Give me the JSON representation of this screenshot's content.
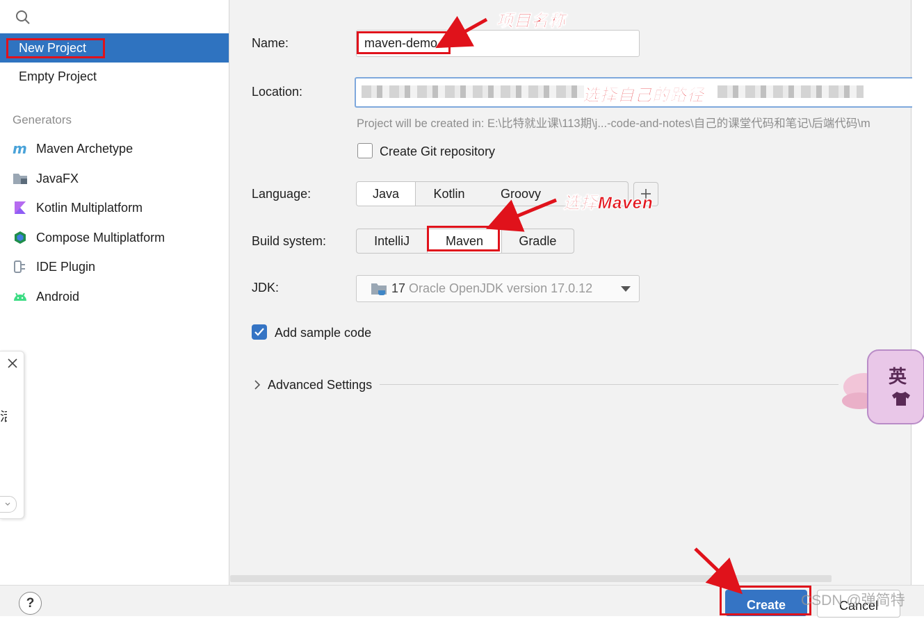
{
  "sidebar": {
    "selected": "New Project",
    "items": [
      {
        "label": "New Project"
      },
      {
        "label": "Empty Project"
      }
    ],
    "generators_heading": "Generators",
    "generators": [
      {
        "label": "Maven Archetype",
        "icon": "maven-icon"
      },
      {
        "label": "JavaFX",
        "icon": "folder-icon"
      },
      {
        "label": "Kotlin Multiplatform",
        "icon": "kotlin-icon"
      },
      {
        "label": "Compose Multiplatform",
        "icon": "compose-icon"
      },
      {
        "label": "IDE Plugin",
        "icon": "plugin-icon"
      },
      {
        "label": "Android",
        "icon": "android-icon"
      }
    ]
  },
  "popup": {
    "partial_text": "活"
  },
  "form": {
    "name_label": "Name:",
    "name_value": "maven-demo",
    "location_label": "Location:",
    "project_path_hint": "Project will be created in: E:\\比特就业课\\113期\\j...-code-and-notes\\自己的课堂代码和笔记\\后端代码\\m",
    "git_label": "Create Git repository",
    "git_checked": false,
    "language_label": "Language:",
    "languages": [
      "Java",
      "Kotlin",
      "Groovy"
    ],
    "language_selected": "Java",
    "build_label": "Build system:",
    "build_systems": [
      "IntelliJ",
      "Maven",
      "Gradle"
    ],
    "build_selected": "Maven",
    "jdk_label": "JDK:",
    "jdk_version": "17",
    "jdk_name": "Oracle OpenJDK version 17.0.12",
    "sample_label": "Add sample code",
    "sample_checked": true,
    "advanced_label": "Advanced Settings"
  },
  "annotations": {
    "name_note": "项目名称",
    "location_note": "选择自己的路径",
    "maven_note": "选择Maven"
  },
  "sticker_text": "英",
  "footer": {
    "help": "?",
    "create": "Create",
    "cancel": "Cancel",
    "watermark": "CSDN @弹简特"
  },
  "colors": {
    "accent": "#2f73c0",
    "annotation_red": "#e0121b"
  }
}
